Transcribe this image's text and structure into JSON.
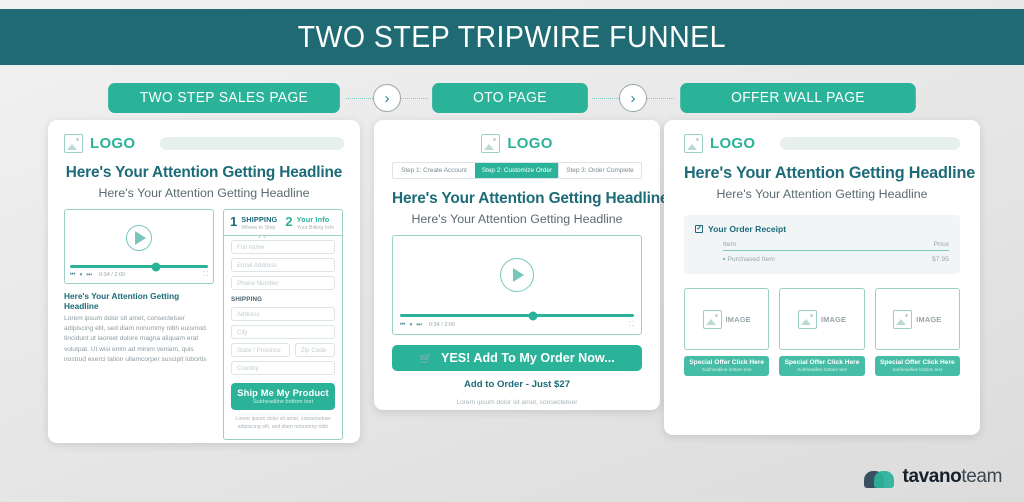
{
  "header": {
    "title": "TWO STEP TRIPWIRE FUNNEL"
  },
  "flow": {
    "steps": [
      {
        "label": "TWO STEP SALES PAGE"
      },
      {
        "label": "OTO PAGE"
      },
      {
        "label": "OFFER WALL PAGE"
      }
    ],
    "connector_glyph": "›"
  },
  "colors": {
    "header_teal": "#206b73",
    "accent_green": "#2bb39a",
    "heading_teal": "#1c6b78",
    "muted_gray": "#9aa7ad"
  },
  "card_sales": {
    "logo_label": "LOGO",
    "headline": "Here's Your Attention Getting Headline",
    "subheadline": "Here's Your Attention Getting Headline",
    "video": {
      "time": "0:34 / 2:00"
    },
    "body_headline": "Here's Your Attention Getting Headline",
    "body_text": "Lorem ipsum dolor sit amet, consectetuer adipiscing elit, sed diam nonummy nibh euismod tincidunt ut laoreet dolore magna aliquam erat volutpat. Ut wisi enim ad minim veniam, quis nostrud exerci tation ullamcorper suscipit lobortis",
    "form": {
      "step1_num": "1",
      "step1_title": "SHIPPING",
      "step1_sub": "Where to Ship",
      "step2_num": "2",
      "step2_title": "Your Info",
      "step2_sub": "Your Billing Info",
      "fields": [
        {
          "placeholder": "Full name"
        },
        {
          "placeholder": "Email Address"
        },
        {
          "placeholder": "Phone Number"
        }
      ],
      "section_label": "SHIPPING",
      "shipping_fields": [
        {
          "placeholder": "Address"
        },
        {
          "placeholder": "City"
        }
      ],
      "state_placeholder": "State / Province",
      "zip_placeholder": "Zip Code",
      "country_placeholder": "Country",
      "cta_label": "Ship Me My Product",
      "cta_sub": "Subheadline bottom text",
      "fine_print": "Lorem ipsum dolor sit amet, consectetuer adipiscing elit, sed diam nonummy nibh"
    }
  },
  "card_oto": {
    "logo_label": "LOGO",
    "tabs": [
      {
        "label": "Step 1: Create Account",
        "active": false
      },
      {
        "label": "Step 2: Customize Order",
        "active": true
      },
      {
        "label": "Step 3: Order Complete",
        "active": false
      }
    ],
    "headline": "Here's Your Attention Getting Headline",
    "subheadline": "Here's Your Attention Getting Headline",
    "video": {
      "time": "0:34 / 2:00"
    },
    "cta_label": "YES! Add To My Order Now...",
    "cta_icon": "cart-icon",
    "add_to_order": "Add to Order - Just $27",
    "fine_print": "Lorem ipsum dolor sit amet, consectetuer"
  },
  "card_offerwall": {
    "logo_label": "LOGO",
    "headline": "Here's Your Attention Getting Headline",
    "subheadline": "Here's Your Attention Getting Headline",
    "receipt": {
      "title": "Your Order Receipt",
      "col_item": "Item",
      "col_price": "Price",
      "rows": [
        {
          "name": "Purchased Item",
          "price": "$7.95"
        }
      ]
    },
    "offers": [
      {
        "image_label": "IMAGE",
        "cta": "Special Offer Click Here",
        "cta_sub": "Subheadline bottom text"
      },
      {
        "image_label": "IMAGE",
        "cta": "Special Offer Click Here",
        "cta_sub": "Subheadline bottom text"
      },
      {
        "image_label": "IMAGE",
        "cta": "Special Offer Click Here",
        "cta_sub": "Subheadline bottom text"
      }
    ]
  },
  "footer": {
    "brand_bold": "tavano",
    "brand_light": "team"
  }
}
